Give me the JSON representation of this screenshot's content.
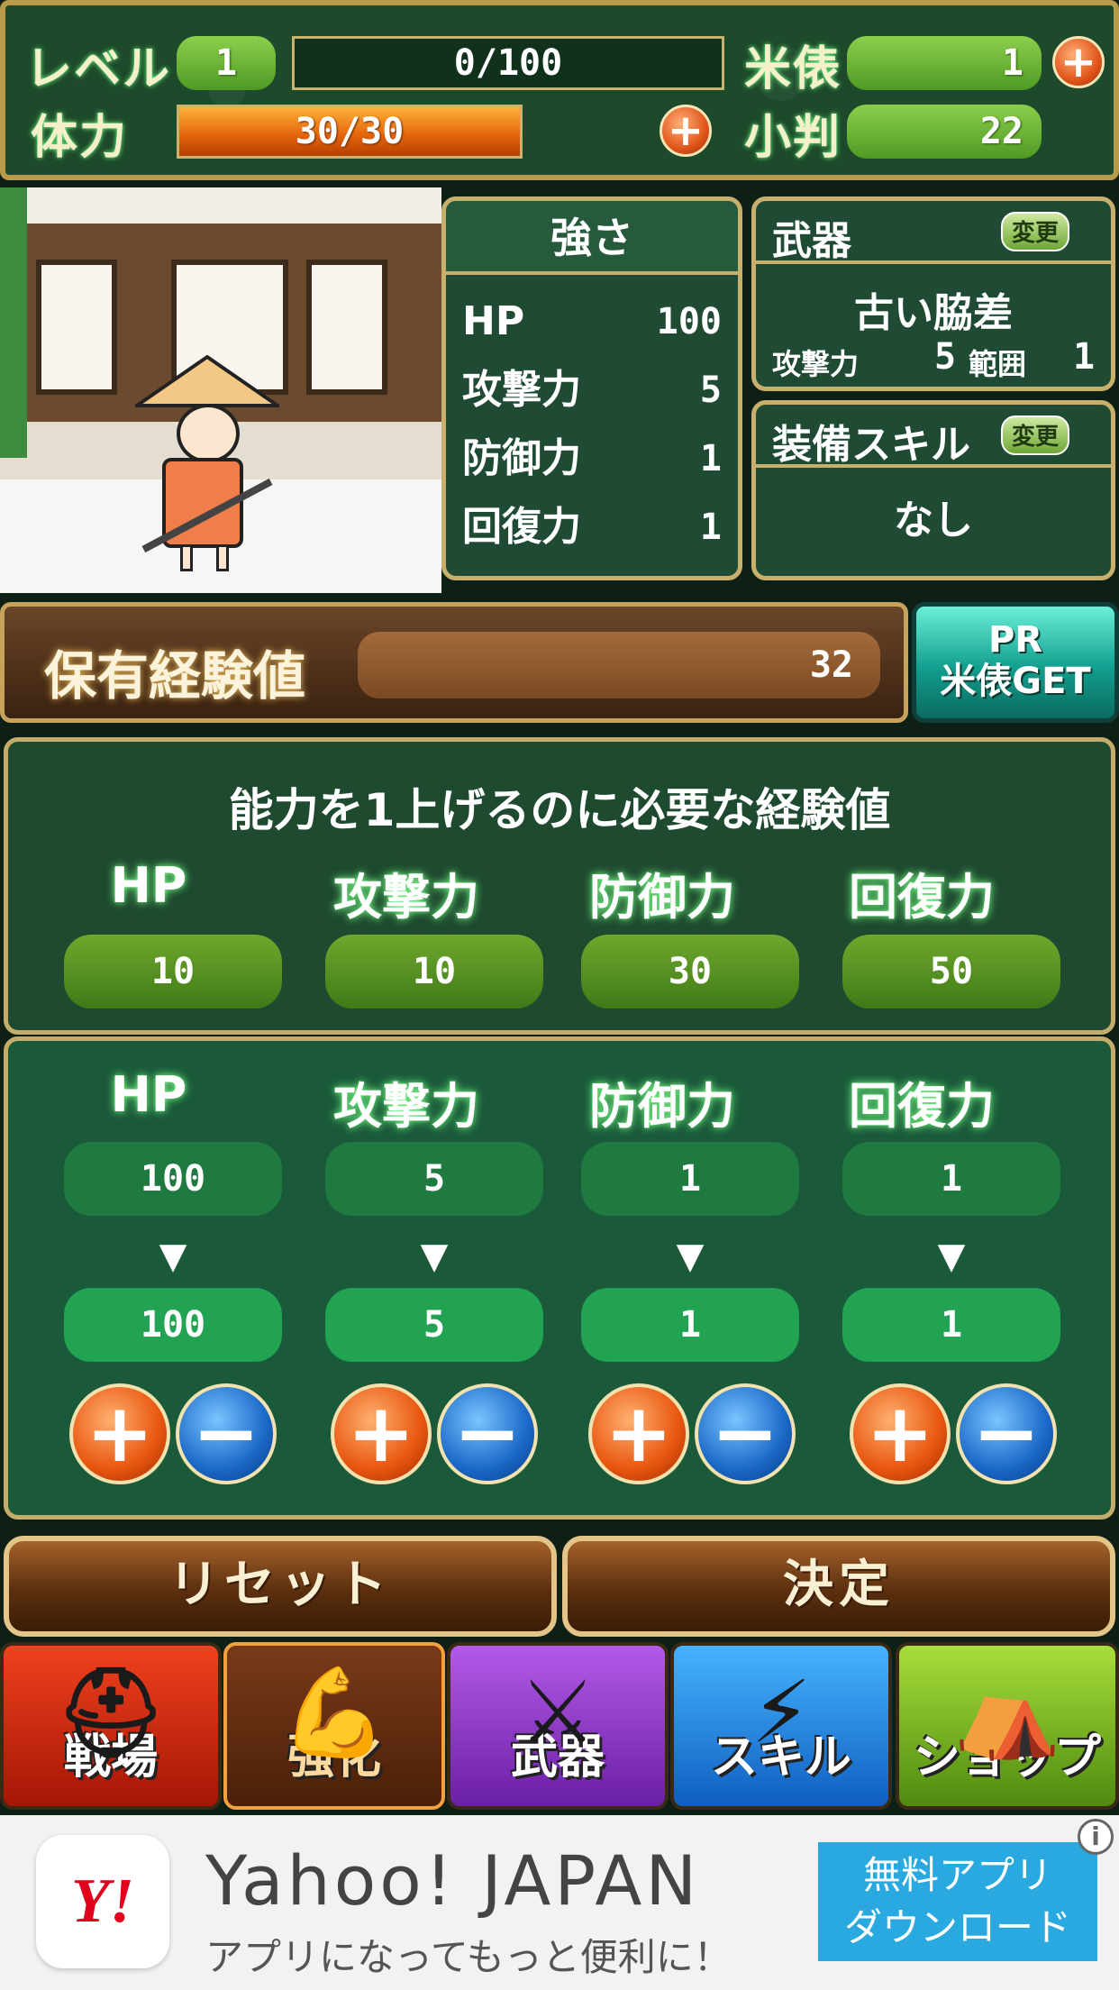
{
  "status": {
    "level_label": "レベル",
    "level_value": "1",
    "exp_value": "0/100",
    "rice_label": "米俵",
    "rice_value": "1",
    "stamina_label": "体力",
    "stamina_value": "30/30",
    "stamina_fill": 1.0,
    "koban_label": "小判",
    "koban_value": "22"
  },
  "strength": {
    "title": "強さ",
    "rows": [
      {
        "label": "HP",
        "value": "100"
      },
      {
        "label": "攻撃力",
        "value": "5"
      },
      {
        "label": "防御力",
        "value": "1"
      },
      {
        "label": "回復力",
        "value": "1"
      }
    ]
  },
  "weapon": {
    "title": "武器",
    "change_label": "変更",
    "name": "古い脇差",
    "attack_label": "攻撃力",
    "attack_value": "5",
    "range_label": "範囲",
    "range_value": "1"
  },
  "skill": {
    "title": "装備スキル",
    "change_label": "変更",
    "value": "なし"
  },
  "exp": {
    "label": "保有経験値",
    "value": "32"
  },
  "pr_button": {
    "line1": "PR",
    "line2": "米俵GET"
  },
  "cost_section": {
    "heading": "能力を1上げるのに必要な経験値",
    "columns": [
      {
        "label": "HP",
        "cost": "10"
      },
      {
        "label": "攻撃力",
        "cost": "10"
      },
      {
        "label": "防御力",
        "cost": "30"
      },
      {
        "label": "回復力",
        "cost": "50"
      }
    ]
  },
  "stat_section": {
    "arrow": "▼",
    "columns": [
      {
        "label": "HP",
        "current": "100",
        "next": "100"
      },
      {
        "label": "攻撃力",
        "current": "5",
        "next": "5"
      },
      {
        "label": "防御力",
        "current": "1",
        "next": "1"
      },
      {
        "label": "回復力",
        "current": "1",
        "next": "1"
      }
    ]
  },
  "actions": {
    "reset": "リセット",
    "confirm": "決定"
  },
  "tabs": [
    {
      "label": "戦場",
      "icon": "helmet-icon",
      "color": "#c8240e"
    },
    {
      "label": "強化",
      "icon": "arm-icon",
      "color": "#9a3d12"
    },
    {
      "label": "武器",
      "icon": "swords-icon",
      "color": "#7a2fb0"
    },
    {
      "label": "スキル",
      "icon": "lightning-icon",
      "color": "#1d7fd6"
    },
    {
      "label": "ショップ",
      "icon": "shop-icon",
      "color": "#6a9f1a"
    }
  ],
  "ad": {
    "logo": "Y!",
    "title": "Yahoo! JAPAN",
    "subtitle": "アプリになってもっと便利に！",
    "cta_line1": "無料アプリ",
    "cta_line2": "ダウンロード"
  }
}
